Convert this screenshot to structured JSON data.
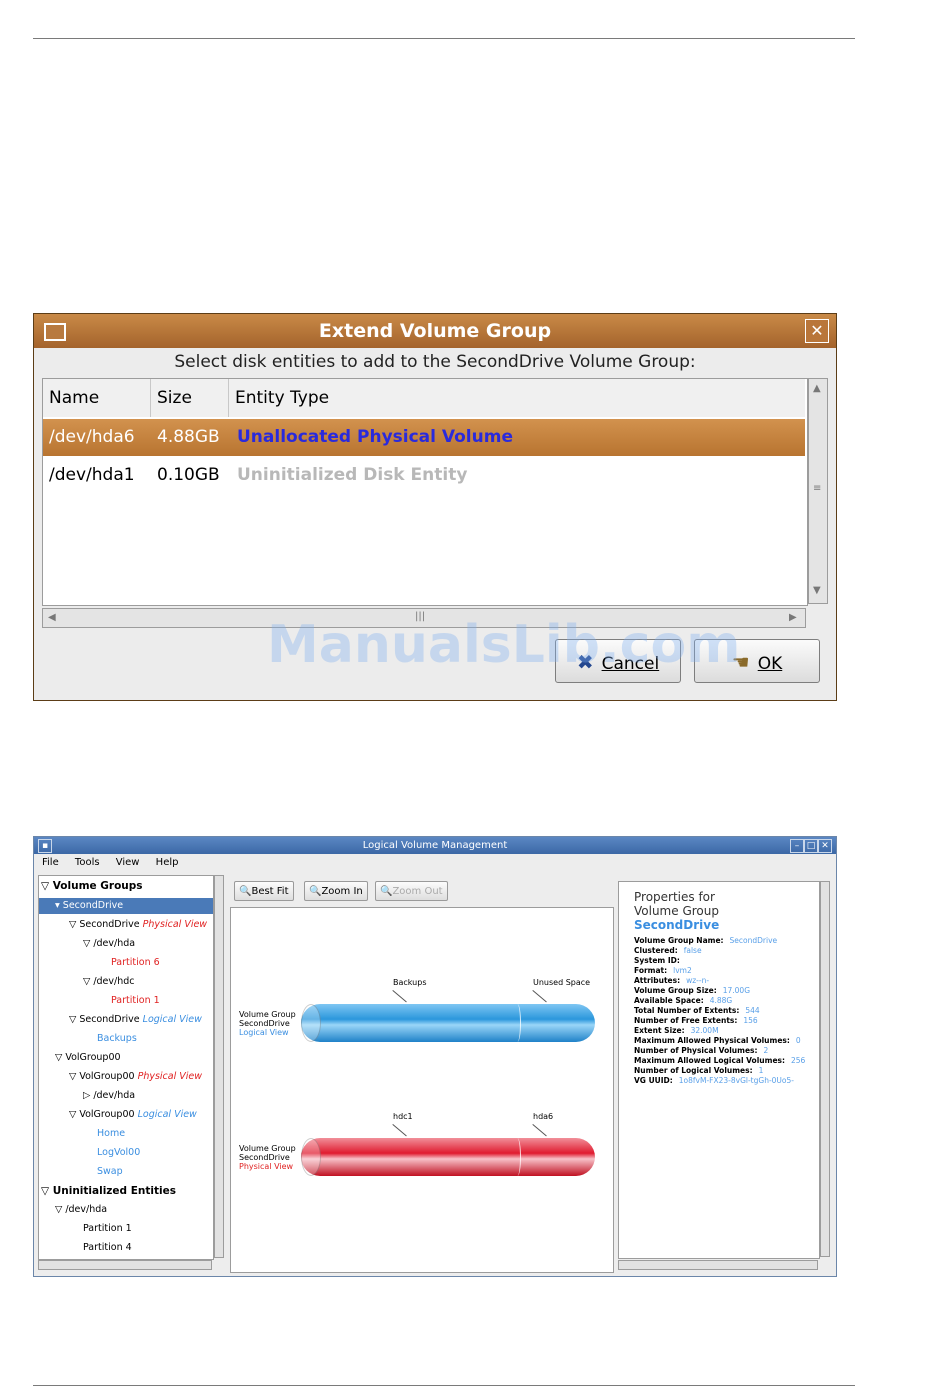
{
  "dialog": {
    "title": "Extend Volume Group",
    "subtitle": "Select disk entities to add to the SecondDrive Volume Group:",
    "columns": [
      "Name",
      "Size",
      "Entity Type"
    ],
    "rows": [
      {
        "name": "/dev/hda6",
        "size": "4.88GB",
        "type": "Unallocated Physical Volume",
        "type_color": "#2a2adc",
        "selected": true
      },
      {
        "name": "/dev/hda1",
        "size": "0.10GB",
        "type": "Uninitialized Disk Entity",
        "type_color": "#b8b8b8",
        "selected": false
      }
    ],
    "cancel_label": "Cancel",
    "ok_label": "OK"
  },
  "watermark": "ManualsLib.com",
  "lvm": {
    "title": "Logical Volume Management",
    "menu": [
      "File",
      "Tools",
      "View",
      "Help"
    ],
    "toolbar": {
      "best_fit": "Best Fit",
      "zoom_in": "Zoom In",
      "zoom_out": "Zoom Out"
    },
    "tree": [
      {
        "text": "Volume Groups",
        "bold": true
      },
      {
        "text": "SecondDrive",
        "selected": true
      },
      {
        "text": "SecondDrive",
        "tag": "Physical View",
        "tag_color": "red"
      },
      {
        "text": "/dev/hda"
      },
      {
        "text": "Partition 6",
        "color": "red"
      },
      {
        "text": "/dev/hdc"
      },
      {
        "text": "Partition 1",
        "color": "red"
      },
      {
        "text": "SecondDrive",
        "tag": "Logical View",
        "tag_color": "blue"
      },
      {
        "text": "Backups",
        "color": "blue"
      },
      {
        "text": "VolGroup00"
      },
      {
        "text": "VolGroup00",
        "tag": "Physical View",
        "tag_color": "red"
      },
      {
        "text": "/dev/hda"
      },
      {
        "text": "VolGroup00",
        "tag": "Logical View",
        "tag_color": "blue"
      },
      {
        "text": "Home",
        "color": "blue"
      },
      {
        "text": "LogVol00",
        "color": "blue"
      },
      {
        "text": "Swap",
        "color": "blue"
      },
      {
        "text": "Uninitialized Entities",
        "bold": true
      },
      {
        "text": "/dev/hda"
      },
      {
        "text": "Partition 1"
      },
      {
        "text": "Partition 4"
      }
    ],
    "canvas": {
      "logical": {
        "line1": "Volume Group",
        "line2": "SecondDrive",
        "line3": "Logical View",
        "seg1": "Backups",
        "seg2": "Unused Space",
        "color": "#2b97dc"
      },
      "physical": {
        "line1": "Volume Group",
        "line2": "SecondDrive",
        "line3": "Physical View",
        "seg1": "hdc1",
        "seg2": "hda6",
        "color": "#e01b2f"
      }
    },
    "properties": {
      "heading1": "Properties for",
      "heading2": "Volume Group",
      "name": "SecondDrive",
      "fields": [
        {
          "label": "Volume Group Name:",
          "value": "SecondDrive"
        },
        {
          "label": "Clustered:",
          "value": "false"
        },
        {
          "label": "System ID:",
          "value": ""
        },
        {
          "label": "Format:",
          "value": "lvm2"
        },
        {
          "label": "Attributes:",
          "value": "wz--n-"
        },
        {
          "label": "Volume Group Size:",
          "value": "17.00G"
        },
        {
          "label": "Available Space:",
          "value": "4.88G"
        },
        {
          "label": "Total Number of Extents:",
          "value": "544"
        },
        {
          "label": "Number of Free Extents:",
          "value": "156"
        },
        {
          "label": "Extent Size:",
          "value": "32.00M"
        },
        {
          "label": "Maximum Allowed Physical Volumes:",
          "value": "0"
        },
        {
          "label": "Number of Physical Volumes:",
          "value": "2"
        },
        {
          "label": "Maximum Allowed Logical Volumes:",
          "value": "256"
        },
        {
          "label": "Number of Logical Volumes:",
          "value": "1"
        },
        {
          "label": "VG UUID:",
          "value": "1o8fvM-FX23-8vGl-tgGh-0Uo5-"
        }
      ]
    }
  }
}
